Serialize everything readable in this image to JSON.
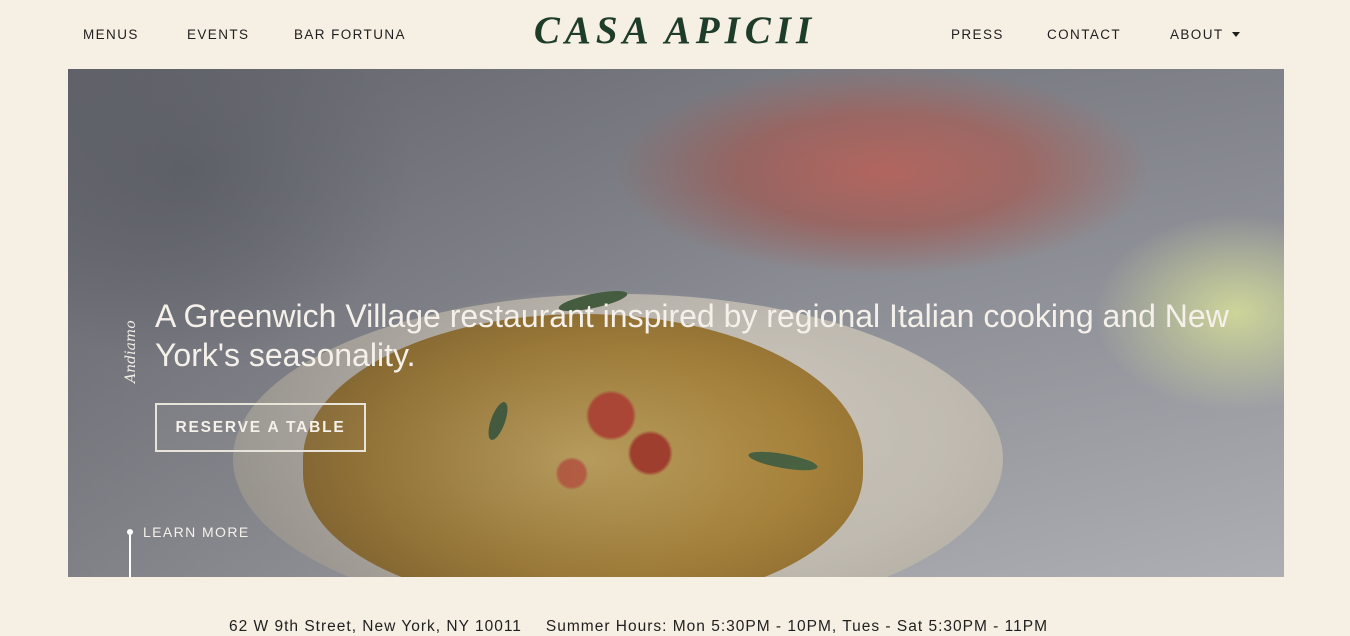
{
  "nav": {
    "left": [
      "MENUS",
      "EVENTS",
      "BAR FORTUNA"
    ],
    "logo": "CASA APICII",
    "right": [
      "PRESS",
      "CONTACT",
      "ABOUT"
    ]
  },
  "hero": {
    "script_word": "Andiamo",
    "heading": "A Greenwich Village restaurant inspired by regional Italian cooking and New York's seasonality.",
    "reserve_label": "RESERVE A TABLE",
    "learn_more_label": "LEARN MORE"
  },
  "info": {
    "address": "62 W 9th Street, New York, NY 10011",
    "hours": "Summer Hours: Mon 5:30PM - 10PM, Tues - Sat 5:30PM - 11PM"
  },
  "colors": {
    "background": "#f6efe4",
    "logo": "#1e3c2a",
    "text": "#1f1f1f"
  }
}
